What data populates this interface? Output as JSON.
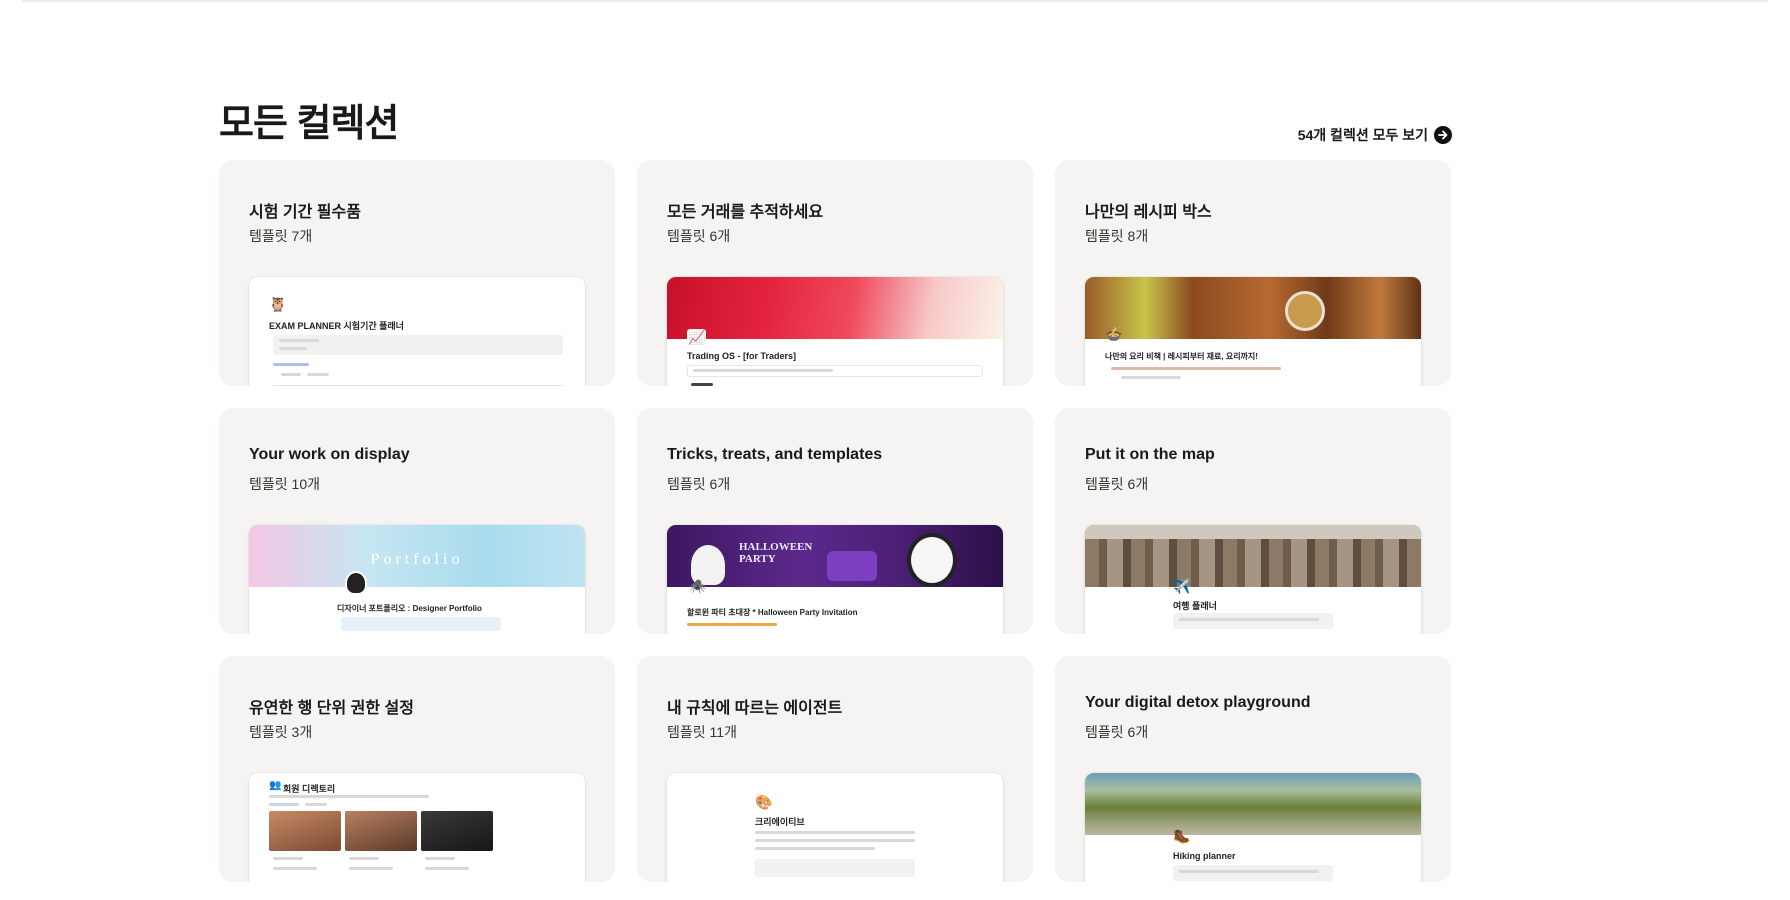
{
  "section": {
    "title": "모든 컬렉션",
    "see_all_label": "54개 컬렉션 모두 보기"
  },
  "cards": [
    {
      "title": "시험 기간 필수품",
      "count": "템플릿 7개",
      "preview_title": "EXAM PLANNER 시험기간 플래너",
      "preview_icon": "owl-scholar-icon"
    },
    {
      "title": "모든 거래를 추적하세요",
      "count": "템플릿 6개",
      "preview_title": "Trading OS - [for Traders]",
      "preview_icon": "chart-icon"
    },
    {
      "title": "나만의 레시피 박스",
      "count": "템플릿 8개",
      "preview_title": "나만의 요리 비책 | 레시피부터 재료, 요리까지!",
      "preview_icon": "cooking-pot-icon"
    },
    {
      "title": "Your work on display",
      "count": "템플릿 10개",
      "preview_title": "디자이너 포트폴리오 : Designer Portfolio",
      "preview_banner_text": "Portfolio",
      "preview_icon": "avatar-icon"
    },
    {
      "title": "Tricks, treats, and templates",
      "count": "템플릿 6개",
      "preview_title": "할로윈 파티 초대장 * Halloween Party Invitation",
      "preview_banner_text": "HALLOWEEN PARTY",
      "preview_icon": "spider-icon"
    },
    {
      "title": "Put it on the map",
      "count": "템플릿 6개",
      "preview_title": "여행 플래너",
      "preview_icon": "airplane-icon"
    },
    {
      "title": "유연한 행 단위 권한 설정",
      "count": "템플릿 3개",
      "preview_title": "회원 디렉토리",
      "preview_icon": "people-icon"
    },
    {
      "title": "내 규칙에 따르는 에이전트",
      "count": "템플릿 11개",
      "preview_title": "크리에이티브",
      "preview_icon": "palette-icon"
    },
    {
      "title": "Your digital detox playground",
      "count": "템플릿 6개",
      "preview_title": "Hiking planner",
      "preview_icon": "hiking-boot-icon"
    }
  ]
}
